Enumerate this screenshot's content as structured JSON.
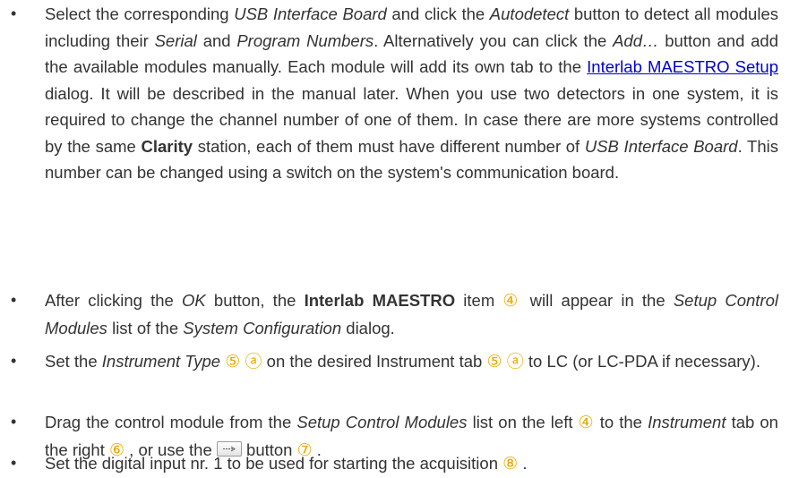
{
  "bullets": [
    {
      "id": "b1",
      "segments": [
        {
          "t": "Select the corresponding ",
          "s": "n"
        },
        {
          "t": "USB Interface Board",
          "s": "i"
        },
        {
          "t": " and click the ",
          "s": "n"
        },
        {
          "t": "Autodetect",
          "s": "i"
        },
        {
          "t": " button to detect all modules including their ",
          "s": "n"
        },
        {
          "t": "Serial",
          "s": "i"
        },
        {
          "t": " and ",
          "s": "n"
        },
        {
          "t": "Program Numbers",
          "s": "i"
        },
        {
          "t": ". Alternatively you can click the ",
          "s": "n"
        },
        {
          "t": "Add…",
          "s": "i"
        },
        {
          "t": " button and add the available modules manually. Each module will add its own tab to the ",
          "s": "n"
        },
        {
          "t": "Interlab MAESTRO Setup",
          "s": "a"
        },
        {
          "t": " dialog. It will be described in the manual later. When you use two detectors in one system, it is required to change the channel number of one of them. In case there are more systems controlled by the same ",
          "s": "n"
        },
        {
          "t": "Clarity",
          "s": "b"
        },
        {
          "t": " station, each of them must have different number of ",
          "s": "n"
        },
        {
          "t": "USB Interface Board",
          "s": "i"
        },
        {
          "t": ". This number can be changed using a switch on the system's communication board.",
          "s": "n"
        }
      ]
    },
    {
      "id": "b2",
      "segments": [
        {
          "t": "After clicking the ",
          "s": "n"
        },
        {
          "t": "OK",
          "s": "i"
        },
        {
          "t": " button, the ",
          "s": "n"
        },
        {
          "t": "Interlab MAESTRO",
          "s": "b"
        },
        {
          "t": " item ",
          "s": "n"
        },
        {
          "t": "④",
          "s": "c"
        },
        {
          "t": "  will appear in the ",
          "s": "n"
        },
        {
          "t": "Setup Control Modules",
          "s": "i"
        },
        {
          "t": " list of the ",
          "s": "n"
        },
        {
          "t": "System Configuration",
          "s": "i"
        },
        {
          "t": " dialog.",
          "s": "n"
        }
      ]
    },
    {
      "id": "b3",
      "segments": [
        {
          "t": "Set the ",
          "s": "n"
        },
        {
          "t": "Instrument Type",
          "s": "i"
        },
        {
          "t": " ",
          "s": "n"
        },
        {
          "t": "⑤ ⓐ",
          "s": "c"
        },
        {
          "t": "  on the desired Instrument tab ",
          "s": "n"
        },
        {
          "t": "⑤ ⓐ",
          "s": "c"
        },
        {
          "t": "  to LC (or LC-PDA if necessary).",
          "s": "n"
        }
      ]
    },
    {
      "id": "b4",
      "segments": [
        {
          "t": "Drag the control module from the ",
          "s": "n"
        },
        {
          "t": "Setup Control Modules",
          "s": "i"
        },
        {
          "t": " list on the left ",
          "s": "n"
        },
        {
          "t": "④",
          "s": "c"
        },
        {
          "t": "  to the ",
          "s": "n"
        },
        {
          "t": "Instrument",
          "s": "i"
        },
        {
          "t": " tab on the right ",
          "s": "n"
        },
        {
          "t": "⑥",
          "s": "c"
        },
        {
          "t": " , or use the ",
          "s": "n"
        },
        {
          "t": "",
          "s": "btn"
        },
        {
          "t": " button ",
          "s": "n"
        },
        {
          "t": "⑦",
          "s": "c"
        },
        {
          "t": " .",
          "s": "n"
        }
      ]
    },
    {
      "id": "b5",
      "segments": [
        {
          "t": "Set the digital input nr. 1 to be used for starting the acquisition ",
          "s": "n"
        },
        {
          "t": "⑧",
          "s": "c"
        },
        {
          "t": " .",
          "s": "n"
        }
      ]
    }
  ],
  "colors": {
    "text": "#333333",
    "link": "#0000cc",
    "callout": "#e8a900"
  },
  "icons": {
    "bullet": "bullet-dot-icon",
    "move_button": "move-right-arrow-icon"
  },
  "bullet_glyph": "•"
}
